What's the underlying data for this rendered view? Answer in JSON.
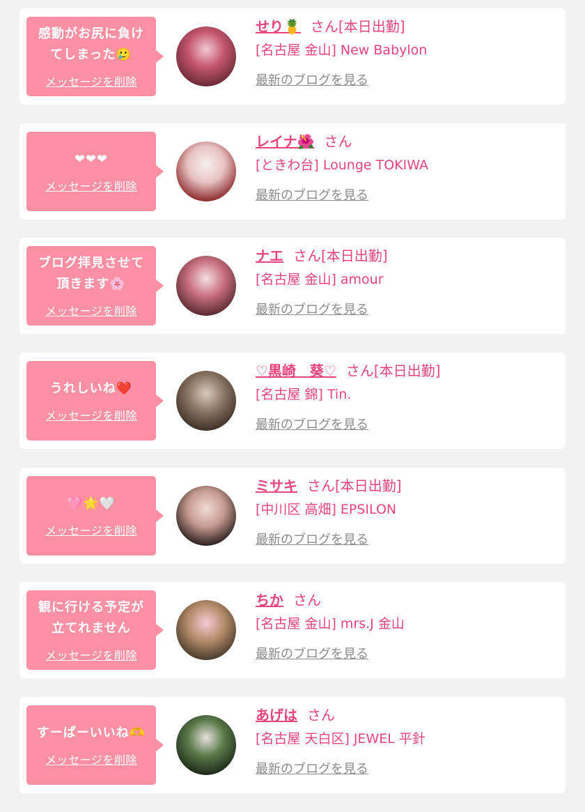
{
  "list": [
    {
      "message": "感動がお尻に負け\nてしまった🥲",
      "delete_label": "メッセージを削除",
      "name": "せり🍍",
      "suffix": "さん[本日出勤]",
      "shop": "[名古屋 金山] New Babylon",
      "blog_link": "最新のブログを見る",
      "avatar_colors": [
        "#6b2a36",
        "#c4566d",
        "#f2c7d2"
      ]
    },
    {
      "message": "❤❤❤",
      "delete_label": "メッセージを削除",
      "name": "レイナ🌺",
      "suffix": "さん",
      "shop": "[ときわ台] Lounge TOKIWA",
      "blog_link": "最新のブログを見る",
      "avatar_colors": [
        "#8d2a2a",
        "#e8c3c3",
        "#f7f0ee"
      ]
    },
    {
      "message": "ブログ拝見させて\n頂きます🌸",
      "delete_label": "メッセージを削除",
      "name": "ナエ",
      "suffix": "さん[本日出勤]",
      "shop": "[名古屋 金山] amour",
      "blog_link": "最新のブログを見る",
      "avatar_colors": [
        "#5a2a30",
        "#c9707e",
        "#f4dfe3"
      ]
    },
    {
      "message": "うれしいね❤️",
      "delete_label": "メッセージを削除",
      "name": "♡黒崎　葵♡",
      "suffix": "さん[本日出勤]",
      "shop": "[名古屋 錦] Tin.",
      "blog_link": "最新のブログを見る",
      "avatar_colors": [
        "#3d3028",
        "#8c7563",
        "#d8cbbd"
      ]
    },
    {
      "message": "🩷🌟🤍",
      "delete_label": "メッセージを削除",
      "name": "ミサキ",
      "suffix": "さん[本日出勤]",
      "shop": "[中川区 高畑] EPSILON",
      "blog_link": "最新のブログを見る",
      "avatar_colors": [
        "#2b1f1f",
        "#c79b90",
        "#f1dcd6"
      ]
    },
    {
      "message": "観に行ける予定が\n立てれません",
      "delete_label": "メッセージを削除",
      "name": "ちか",
      "suffix": "さん",
      "shop": "[名古屋 金山] mrs.J 金山",
      "blog_link": "最新のブログを見る",
      "avatar_colors": [
        "#4a3a2c",
        "#b58d6b",
        "#f5c9d5"
      ]
    },
    {
      "message": "すーぱーいいね🫶",
      "delete_label": "メッセージを削除",
      "name": "あげは",
      "suffix": "さん",
      "shop": "[名古屋 天白区] JEWEL 平針",
      "blog_link": "最新のブログを見る",
      "avatar_colors": [
        "#1d2a1a",
        "#5a7a4a",
        "#e7e2dc"
      ]
    }
  ]
}
